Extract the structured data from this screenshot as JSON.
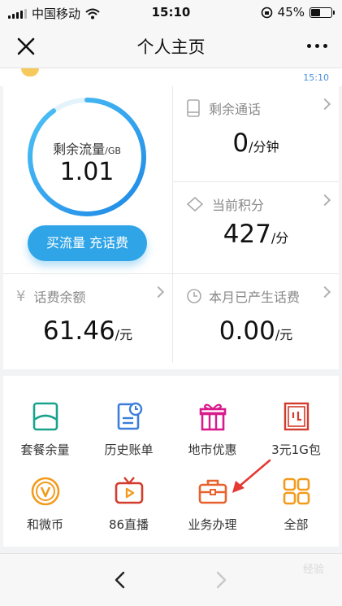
{
  "status_bar": {
    "carrier": "中国移动",
    "time": "15:10",
    "battery": "45%",
    "battery_level": 0.45
  },
  "nav": {
    "title": "个人主页"
  },
  "strip": {
    "timestamp": "15:10"
  },
  "data_usage": {
    "label": "剩余流量",
    "unit": "/GB",
    "value": "1.01",
    "fraction": 0.9
  },
  "buy_button": "买流量 充话费",
  "tiles": {
    "calls": {
      "label": "剩余通话",
      "value": "0",
      "unit": "/分钟"
    },
    "points": {
      "label": "当前积分",
      "value": "427",
      "unit": "/分"
    },
    "balance": {
      "label": "话费余额",
      "value": "61.46",
      "unit": "/元",
      "icon": "¥"
    },
    "charges": {
      "label": "本月已产生话费",
      "value": "0.00",
      "unit": "/元"
    }
  },
  "services": [
    {
      "label": "套餐余量",
      "icon": "package-icon"
    },
    {
      "label": "历史账单",
      "icon": "bill-history-icon"
    },
    {
      "label": "地市优惠",
      "icon": "gift-icon"
    },
    {
      "label": "3元1G包",
      "icon": "data-pack-icon"
    },
    {
      "label": "和微币",
      "icon": "coin-icon"
    },
    {
      "label": "86直播",
      "icon": "tv-icon"
    },
    {
      "label": "业务办理",
      "icon": "briefcase-icon"
    },
    {
      "label": "全部",
      "icon": "grid-icon"
    }
  ],
  "colors": {
    "accent": "#2fa4e7",
    "gauge_start": "#1e88e5",
    "gauge_end": "#4fc3f7",
    "teal": "#1aa38c",
    "pink": "#d81b8c",
    "red": "#d33b2c",
    "orange": "#f29b1d",
    "arrow": "#e53935"
  },
  "watermark": "经验"
}
